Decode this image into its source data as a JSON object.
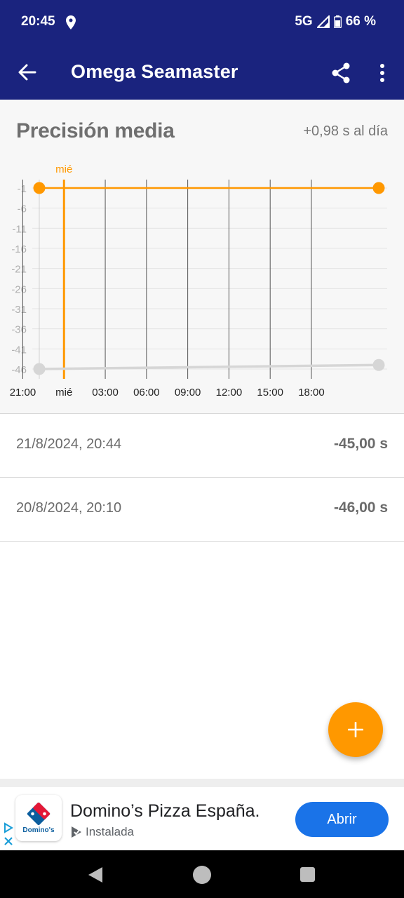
{
  "status_bar": {
    "time": "20:45",
    "network": "5G",
    "battery": "66 %"
  },
  "app_bar": {
    "title": "Omega Seamaster",
    "back_icon": "arrow-back-icon",
    "share_icon": "share-icon",
    "more_icon": "more-vert-icon"
  },
  "summary": {
    "title": "Precisión media",
    "value": "+0,98 s al día"
  },
  "chart_data": {
    "type": "line",
    "title": "",
    "xlabel": "",
    "ylabel": "",
    "x_tick_labels": [
      "21:00",
      "mié",
      "03:00",
      "06:00",
      "09:00",
      "12:00",
      "15:00",
      "18:00"
    ],
    "y_tick_labels": [
      "-1",
      "-6",
      "-11",
      "-16",
      "-21",
      "-26",
      "-31",
      "-36",
      "-41",
      "-46"
    ],
    "ylim": [
      -46,
      -1
    ],
    "xlim_hours": [
      -1.8,
      22.9
    ],
    "day_marker": {
      "label": "mié",
      "x_hours": 0,
      "color": "#ff9800"
    },
    "series": [
      {
        "color": "#ff9800",
        "points": [
          {
            "x_hours": -1.8,
            "y": -1
          },
          {
            "x_hours": 22.9,
            "y": -1
          }
        ]
      },
      {
        "color": "#d6d6d6",
        "points": [
          {
            "x_hours": -1.8,
            "y": -46
          },
          {
            "x_hours": 22.9,
            "y": -45
          }
        ]
      }
    ],
    "grid": true
  },
  "records": [
    {
      "date": "21/8/2024, 20:44",
      "value": "-45,00 s"
    },
    {
      "date": "20/8/2024, 20:10",
      "value": "-46,00 s"
    }
  ],
  "fab": {
    "icon": "plus-icon",
    "color": "#ff9800"
  },
  "ad": {
    "logo_text": "Domino's",
    "title": "Domino’s Pizza España.",
    "subtitle": "Instalada",
    "button": "Abrir"
  },
  "colors": {
    "primary": "#1a237e",
    "accent": "#ff9800",
    "ad_button": "#1a73e8"
  }
}
